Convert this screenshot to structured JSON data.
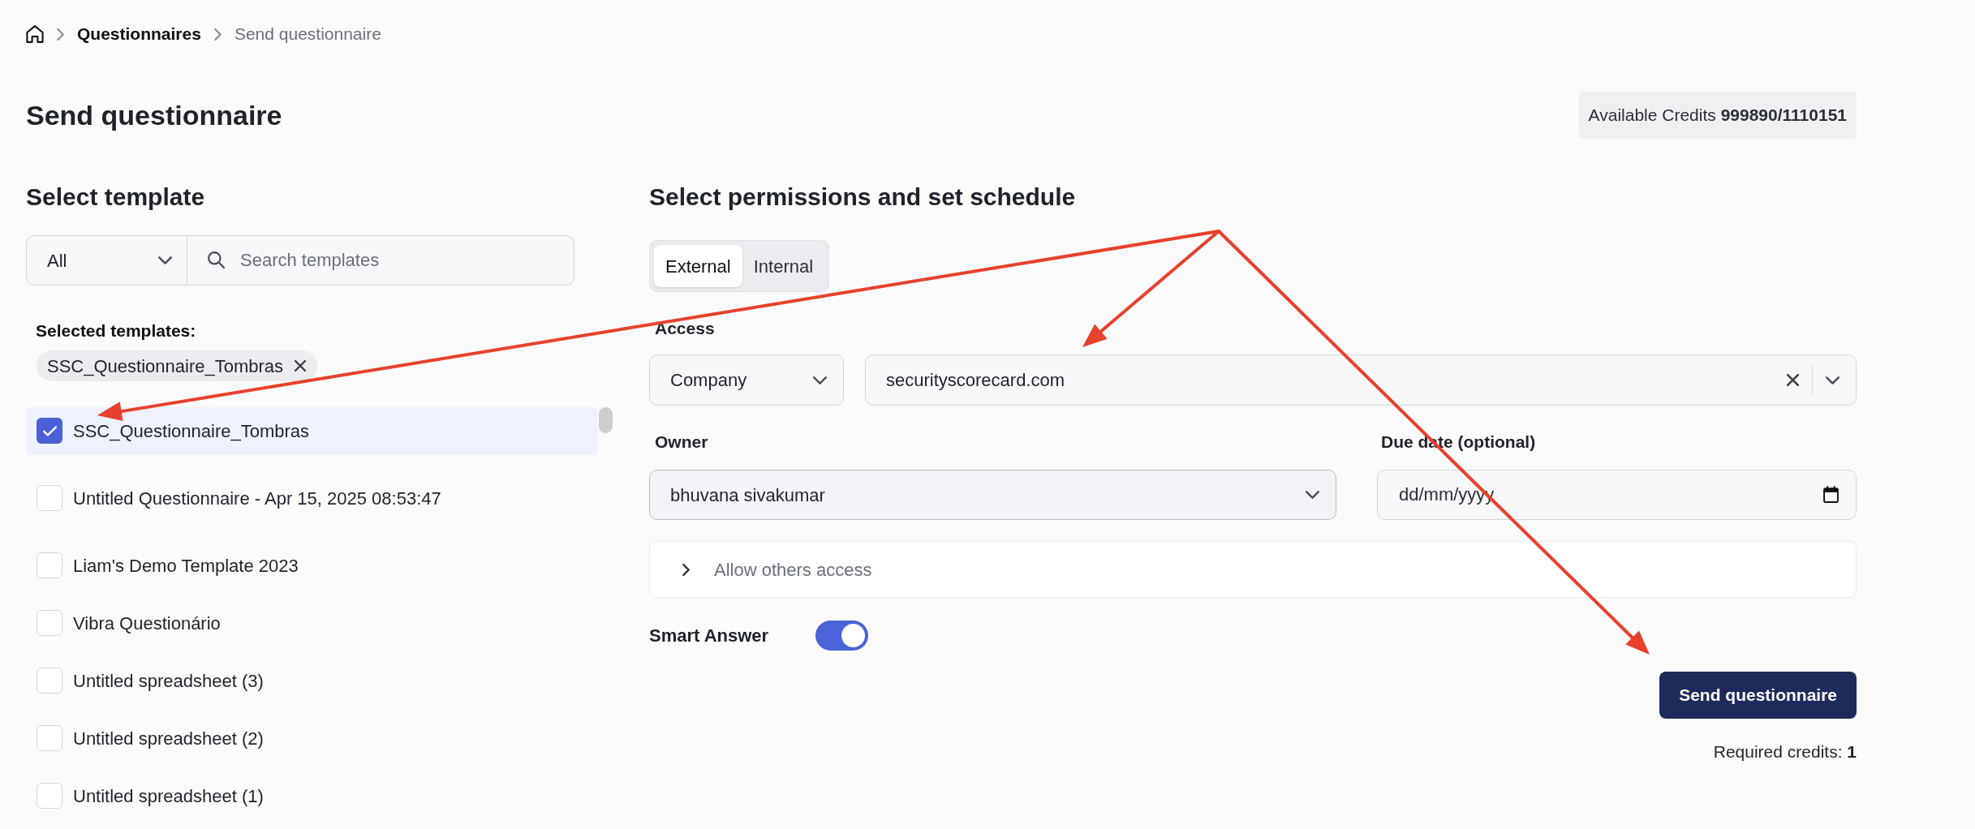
{
  "breadcrumb": [
    {
      "label": "Questionnaires",
      "current": false
    },
    {
      "label": "Send questionnaire",
      "current": true
    }
  ],
  "header": {
    "title": "Send questionnaire",
    "credits": "Available Credits **999890/1110151**"
  },
  "template_panel": {
    "title": "Select template",
    "category_filter": {
      "value": "All"
    },
    "search": {
      "placeholder": "Search templates"
    },
    "selected_label": "Selected templates:",
    "selected_chips": [
      {
        "label": "SSC_Questionnaire_Tombras"
      }
    ],
    "templates": [
      {
        "label": "SSC_Questionnaire_Tombras",
        "checked": true
      },
      {
        "label": "Untitled Questionnaire - Apr 15, 2025 08:53:47",
        "checked": false
      },
      {
        "label": "Liam's Demo Template 2023",
        "checked": false
      },
      {
        "label": "Vibra Questionário",
        "checked": false
      },
      {
        "label": "Untitled spreadsheet (3)",
        "checked": false
      },
      {
        "label": "Untitled spreadsheet (2)",
        "checked": false
      },
      {
        "label": "Untitled spreadsheet (1)",
        "checked": false
      }
    ]
  },
  "permissions_panel": {
    "title": "Select permissions and set schedule",
    "tabs": [
      {
        "label": "External",
        "selected": true
      },
      {
        "label": "Internal",
        "selected": false
      }
    ],
    "access": {
      "label": "Access",
      "type": {
        "value": "Company"
      },
      "domain": {
        "value": "securityscorecard.com"
      }
    },
    "owner": {
      "label": "Owner",
      "value": "bhuvana sivakumar"
    },
    "due_date": {
      "label": "Due date (optional)",
      "placeholder": "dd/mm/yyyy"
    },
    "allow_others": {
      "label": "Allow others access",
      "expanded": false
    },
    "smart_answer": {
      "label": "Smart Answer",
      "on": true
    }
  },
  "footer": {
    "button": "Send questionnaire",
    "required_credits": "Required credits: **1**"
  }
}
